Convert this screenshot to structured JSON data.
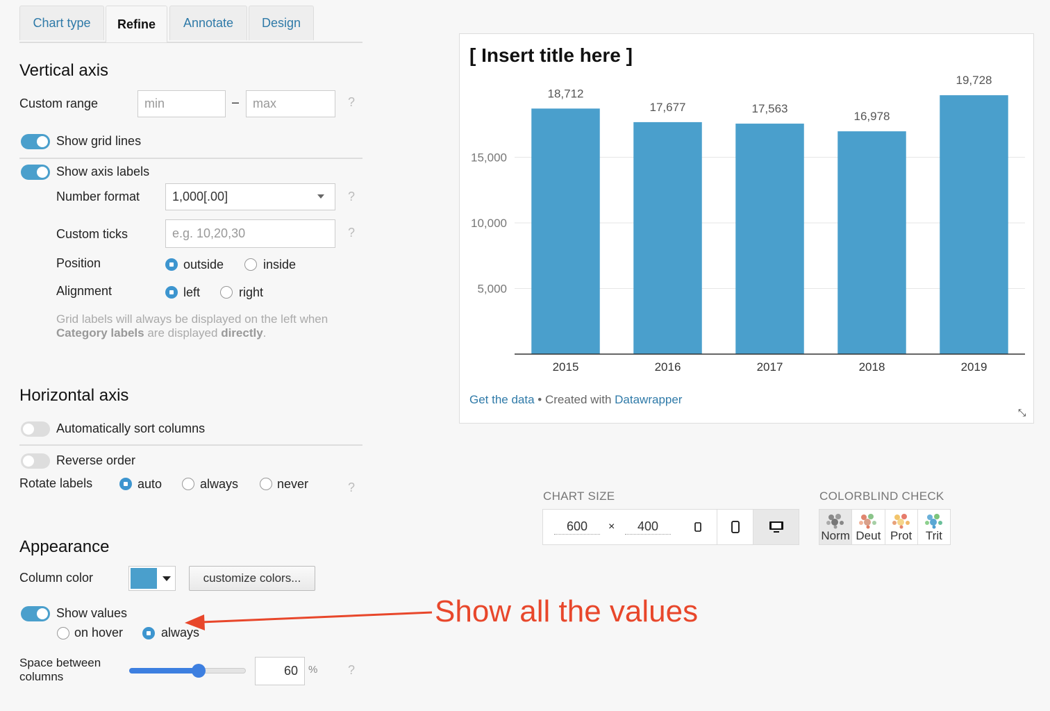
{
  "tabs": [
    "Chart type",
    "Refine",
    "Annotate",
    "Design"
  ],
  "active_tab": "Refine",
  "vertical_axis": {
    "heading": "Vertical axis",
    "custom_range_label": "Custom range",
    "min_placeholder": "min",
    "max_placeholder": "max",
    "dash": "–",
    "help": "?",
    "show_grid_lines": {
      "label": "Show grid lines",
      "on": true
    },
    "show_axis_labels": {
      "label": "Show axis labels",
      "on": true
    },
    "number_format": {
      "label": "Number format",
      "value": "1,000[.00]"
    },
    "custom_ticks": {
      "label": "Custom ticks",
      "placeholder": "e.g. 10,20,30"
    },
    "position": {
      "label": "Position",
      "options": [
        "outside",
        "inside"
      ],
      "selected": "outside"
    },
    "alignment": {
      "label": "Alignment",
      "options": [
        "left",
        "right"
      ],
      "selected": "left"
    },
    "hint_line1": "Grid labels will always be displayed on the left when",
    "hint_b1": "Category labels",
    "hint_mid": " are displayed ",
    "hint_b2": "directly",
    "hint_end": "."
  },
  "horizontal_axis": {
    "heading": "Horizontal axis",
    "auto_sort": {
      "label": "Automatically sort columns",
      "on": false
    },
    "reverse": {
      "label": "Reverse order",
      "on": false
    },
    "rotate_labels": {
      "label": "Rotate labels",
      "options": [
        "auto",
        "always",
        "never"
      ],
      "selected": "auto"
    }
  },
  "appearance": {
    "heading": "Appearance",
    "column_color_label": "Column color",
    "column_color": "#4a9fcc",
    "customize_button": "customize colors...",
    "show_values": {
      "label": "Show values",
      "on": true
    },
    "show_values_mode": {
      "options": [
        "on hover",
        "always"
      ],
      "selected": "always"
    },
    "space_label_1": "Space between",
    "space_label_2": "columns",
    "space_value": "60",
    "space_unit": "%",
    "space_percent": 60
  },
  "chart_size": {
    "label": "CHART SIZE",
    "width": "600",
    "height": "400",
    "times": "×"
  },
  "colorblind": {
    "label": "COLORBLIND CHECK",
    "modes": [
      "Norm",
      "Deut",
      "Prot",
      "Trit"
    ]
  },
  "annotation_text": "Show all the values",
  "chart_data": {
    "type": "bar",
    "title": "[ Insert title here ]",
    "categories": [
      "2015",
      "2016",
      "2017",
      "2018",
      "2019"
    ],
    "values": [
      18712,
      17677,
      17563,
      16978,
      19728
    ],
    "value_labels": [
      "18,712",
      "17,677",
      "17,563",
      "16,978",
      "19,728"
    ],
    "y_ticks": [
      5000,
      10000,
      15000
    ],
    "y_tick_labels": [
      "5,000",
      "10,000",
      "15,000"
    ],
    "ylim": [
      0,
      20000
    ],
    "bar_color": "#4a9fcc",
    "grid": true,
    "footer_link1": "Get the data",
    "footer_sep": " • Created with ",
    "footer_link2": "Datawrapper"
  }
}
